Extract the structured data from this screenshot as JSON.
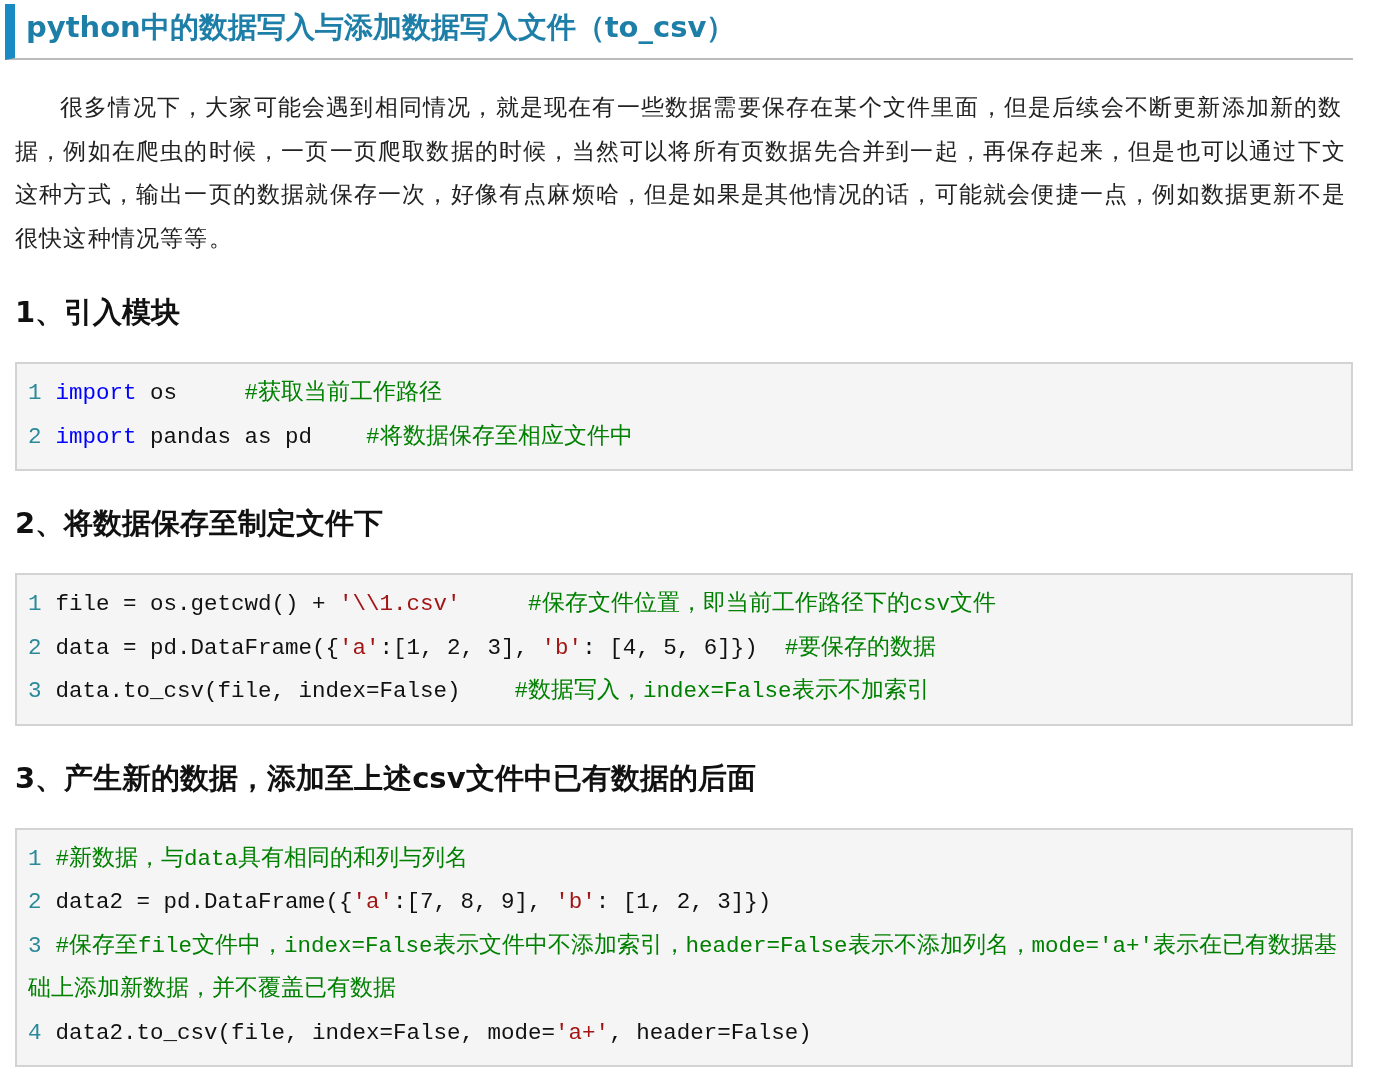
{
  "title": "python中的数据写入与添加数据写入文件（to_csv）",
  "intro": "很多情况下，大家可能会遇到相同情况，就是现在有一些数据需要保存在某个文件里面，但是后续会不断更新添加新的数据，例如在爬虫的时候，一页一页爬取数据的时候，当然可以将所有页数据先合并到一起，再保存起来，但是也可以通过下文这种方式，输出一页的数据就保存一次，好像有点麻烦哈，但是如果是其他情况的话，可能就会便捷一点，例如数据更新不是很快这种情况等等。",
  "sections": [
    {
      "heading": "1、引入模块",
      "code": [
        {
          "number": "1",
          "segments": [
            {
              "kind": "keyword",
              "text": "import"
            },
            {
              "kind": "plain",
              "text": " os     "
            },
            {
              "kind": "comment",
              "text": "#获取当前工作路径"
            }
          ]
        },
        {
          "number": "2",
          "segments": [
            {
              "kind": "keyword",
              "text": "import"
            },
            {
              "kind": "plain",
              "text": " pandas as pd    "
            },
            {
              "kind": "comment",
              "text": "#将数据保存至相应文件中"
            }
          ]
        }
      ]
    },
    {
      "heading": "2、将数据保存至制定文件下",
      "code": [
        {
          "number": "1",
          "segments": [
            {
              "kind": "plain",
              "text": "file = os.getcwd() + "
            },
            {
              "kind": "string",
              "text": "'\\\\1.csv'"
            },
            {
              "kind": "comment",
              "text": "     #保存文件位置，即当前工作路径下的csv文件"
            }
          ]
        },
        {
          "number": "2",
          "segments": [
            {
              "kind": "plain",
              "text": "data = pd.DataFrame({"
            },
            {
              "kind": "string",
              "text": "'a'"
            },
            {
              "kind": "plain",
              "text": ":[1, 2, 3], "
            },
            {
              "kind": "string",
              "text": "'b'"
            },
            {
              "kind": "plain",
              "text": ": [4, 5, 6]})  "
            },
            {
              "kind": "comment",
              "text": "#要保存的数据"
            }
          ]
        },
        {
          "number": "3",
          "segments": [
            {
              "kind": "plain",
              "text": "data.to_csv(file, index=False)    "
            },
            {
              "kind": "comment",
              "text": "#数据写入，index=False表示不加索引"
            }
          ]
        }
      ]
    },
    {
      "heading": "3、产生新的数据，添加至上述csv文件中已有数据的后面",
      "code": [
        {
          "number": "1",
          "segments": [
            {
              "kind": "comment",
              "text": "#新数据，与data具有相同的和列与列名"
            }
          ]
        },
        {
          "number": "2",
          "segments": [
            {
              "kind": "plain",
              "text": "data2 = pd.DataFrame({"
            },
            {
              "kind": "string",
              "text": "'a'"
            },
            {
              "kind": "plain",
              "text": ":[7, 8, 9], "
            },
            {
              "kind": "string",
              "text": "'b'"
            },
            {
              "kind": "plain",
              "text": ": [1, 2, 3]})"
            }
          ]
        },
        {
          "number": "3",
          "segments": [
            {
              "kind": "comment",
              "text": "#保存至file文件中，index=False表示文件中不添加索引，header=False表示不添加列名，mode='a+'表示在已有数据基础上添加新数据，并不覆盖已有数据"
            }
          ]
        },
        {
          "number": "4",
          "segments": [
            {
              "kind": "plain",
              "text": "data2.to_csv(file, index=False, mode="
            },
            {
              "kind": "string",
              "text": "'a+'"
            },
            {
              "kind": "plain",
              "text": ", header=False)"
            }
          ]
        }
      ]
    }
  ]
}
